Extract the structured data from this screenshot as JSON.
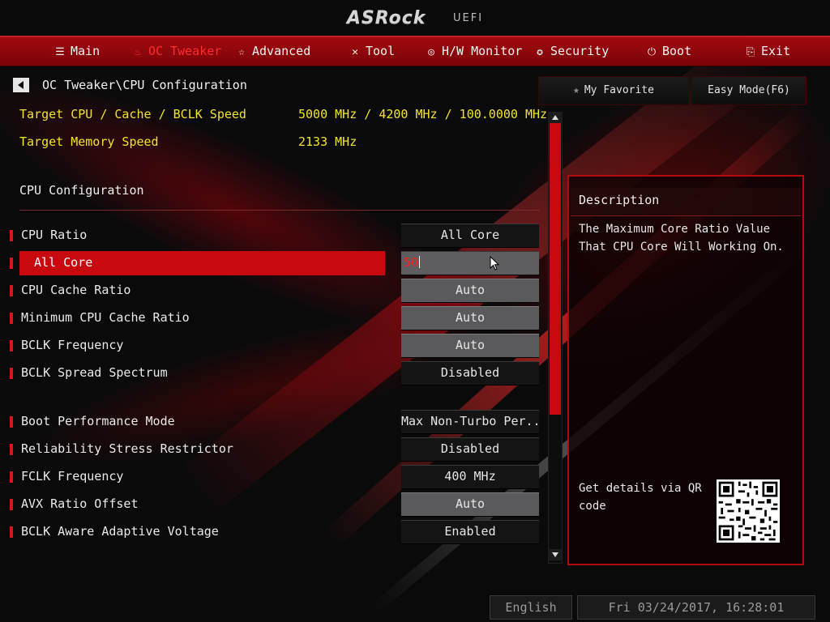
{
  "header": {
    "logo": "ASRock",
    "uefi": "UEFI"
  },
  "menu": [
    {
      "label": "Main",
      "icon": "list-icon"
    },
    {
      "label": "OC Tweaker",
      "icon": "flame-icon",
      "active": true
    },
    {
      "label": "Advanced",
      "icon": "star-icon"
    },
    {
      "label": "Tool",
      "icon": "tools-icon"
    },
    {
      "label": "H/W Monitor",
      "icon": "monitor-icon"
    },
    {
      "label": "Security",
      "icon": "shield-icon"
    },
    {
      "label": "Boot",
      "icon": "power-icon"
    },
    {
      "label": "Exit",
      "icon": "exit-icon"
    }
  ],
  "breadcrumb": "OC Tweaker\\CPU Configuration",
  "targets": [
    {
      "label": "Target CPU / Cache / BCLK Speed",
      "value": "5000 MHz / 4200 MHz / 100.0000 MHz"
    },
    {
      "label": "Target Memory Speed",
      "value": "2133 MHz"
    }
  ],
  "section_title": "CPU Configuration",
  "settings": [
    {
      "label": "CPU Ratio",
      "value": "All Core"
    },
    {
      "label": "All Core",
      "value": "50"
    },
    {
      "label": "CPU Cache Ratio",
      "value": "Auto"
    },
    {
      "label": "Minimum CPU Cache Ratio",
      "value": "Auto"
    },
    {
      "label": "BCLK Frequency",
      "value": "Auto"
    },
    {
      "label": "BCLK Spread Spectrum",
      "value": "Disabled"
    },
    {
      "label": "Boot Performance Mode",
      "value": "Max Non-Turbo Per..."
    },
    {
      "label": "Reliability Stress Restrictor",
      "value": "Disabled"
    },
    {
      "label": "FCLK Frequency",
      "value": "400 MHz"
    },
    {
      "label": "AVX Ratio Offset",
      "value": "Auto"
    },
    {
      "label": "BCLK Aware Adaptive Voltage",
      "value": "Enabled"
    }
  ],
  "right_panel": {
    "favorite_label": "My Favorite",
    "easy_mode_label": "Easy Mode(F6)",
    "description_title": "Description",
    "description_text": "The Maximum Core Ratio Value That CPU Core Will Working On.",
    "qr_text": "Get details via QR code"
  },
  "footer": {
    "language": "English",
    "datetime": "Fri 03/24/2017, 16:28:01"
  },
  "colors": {
    "accent": "#c8090f",
    "highlight_text": "#f3e32a",
    "active_menu": "#ff2a2a"
  }
}
